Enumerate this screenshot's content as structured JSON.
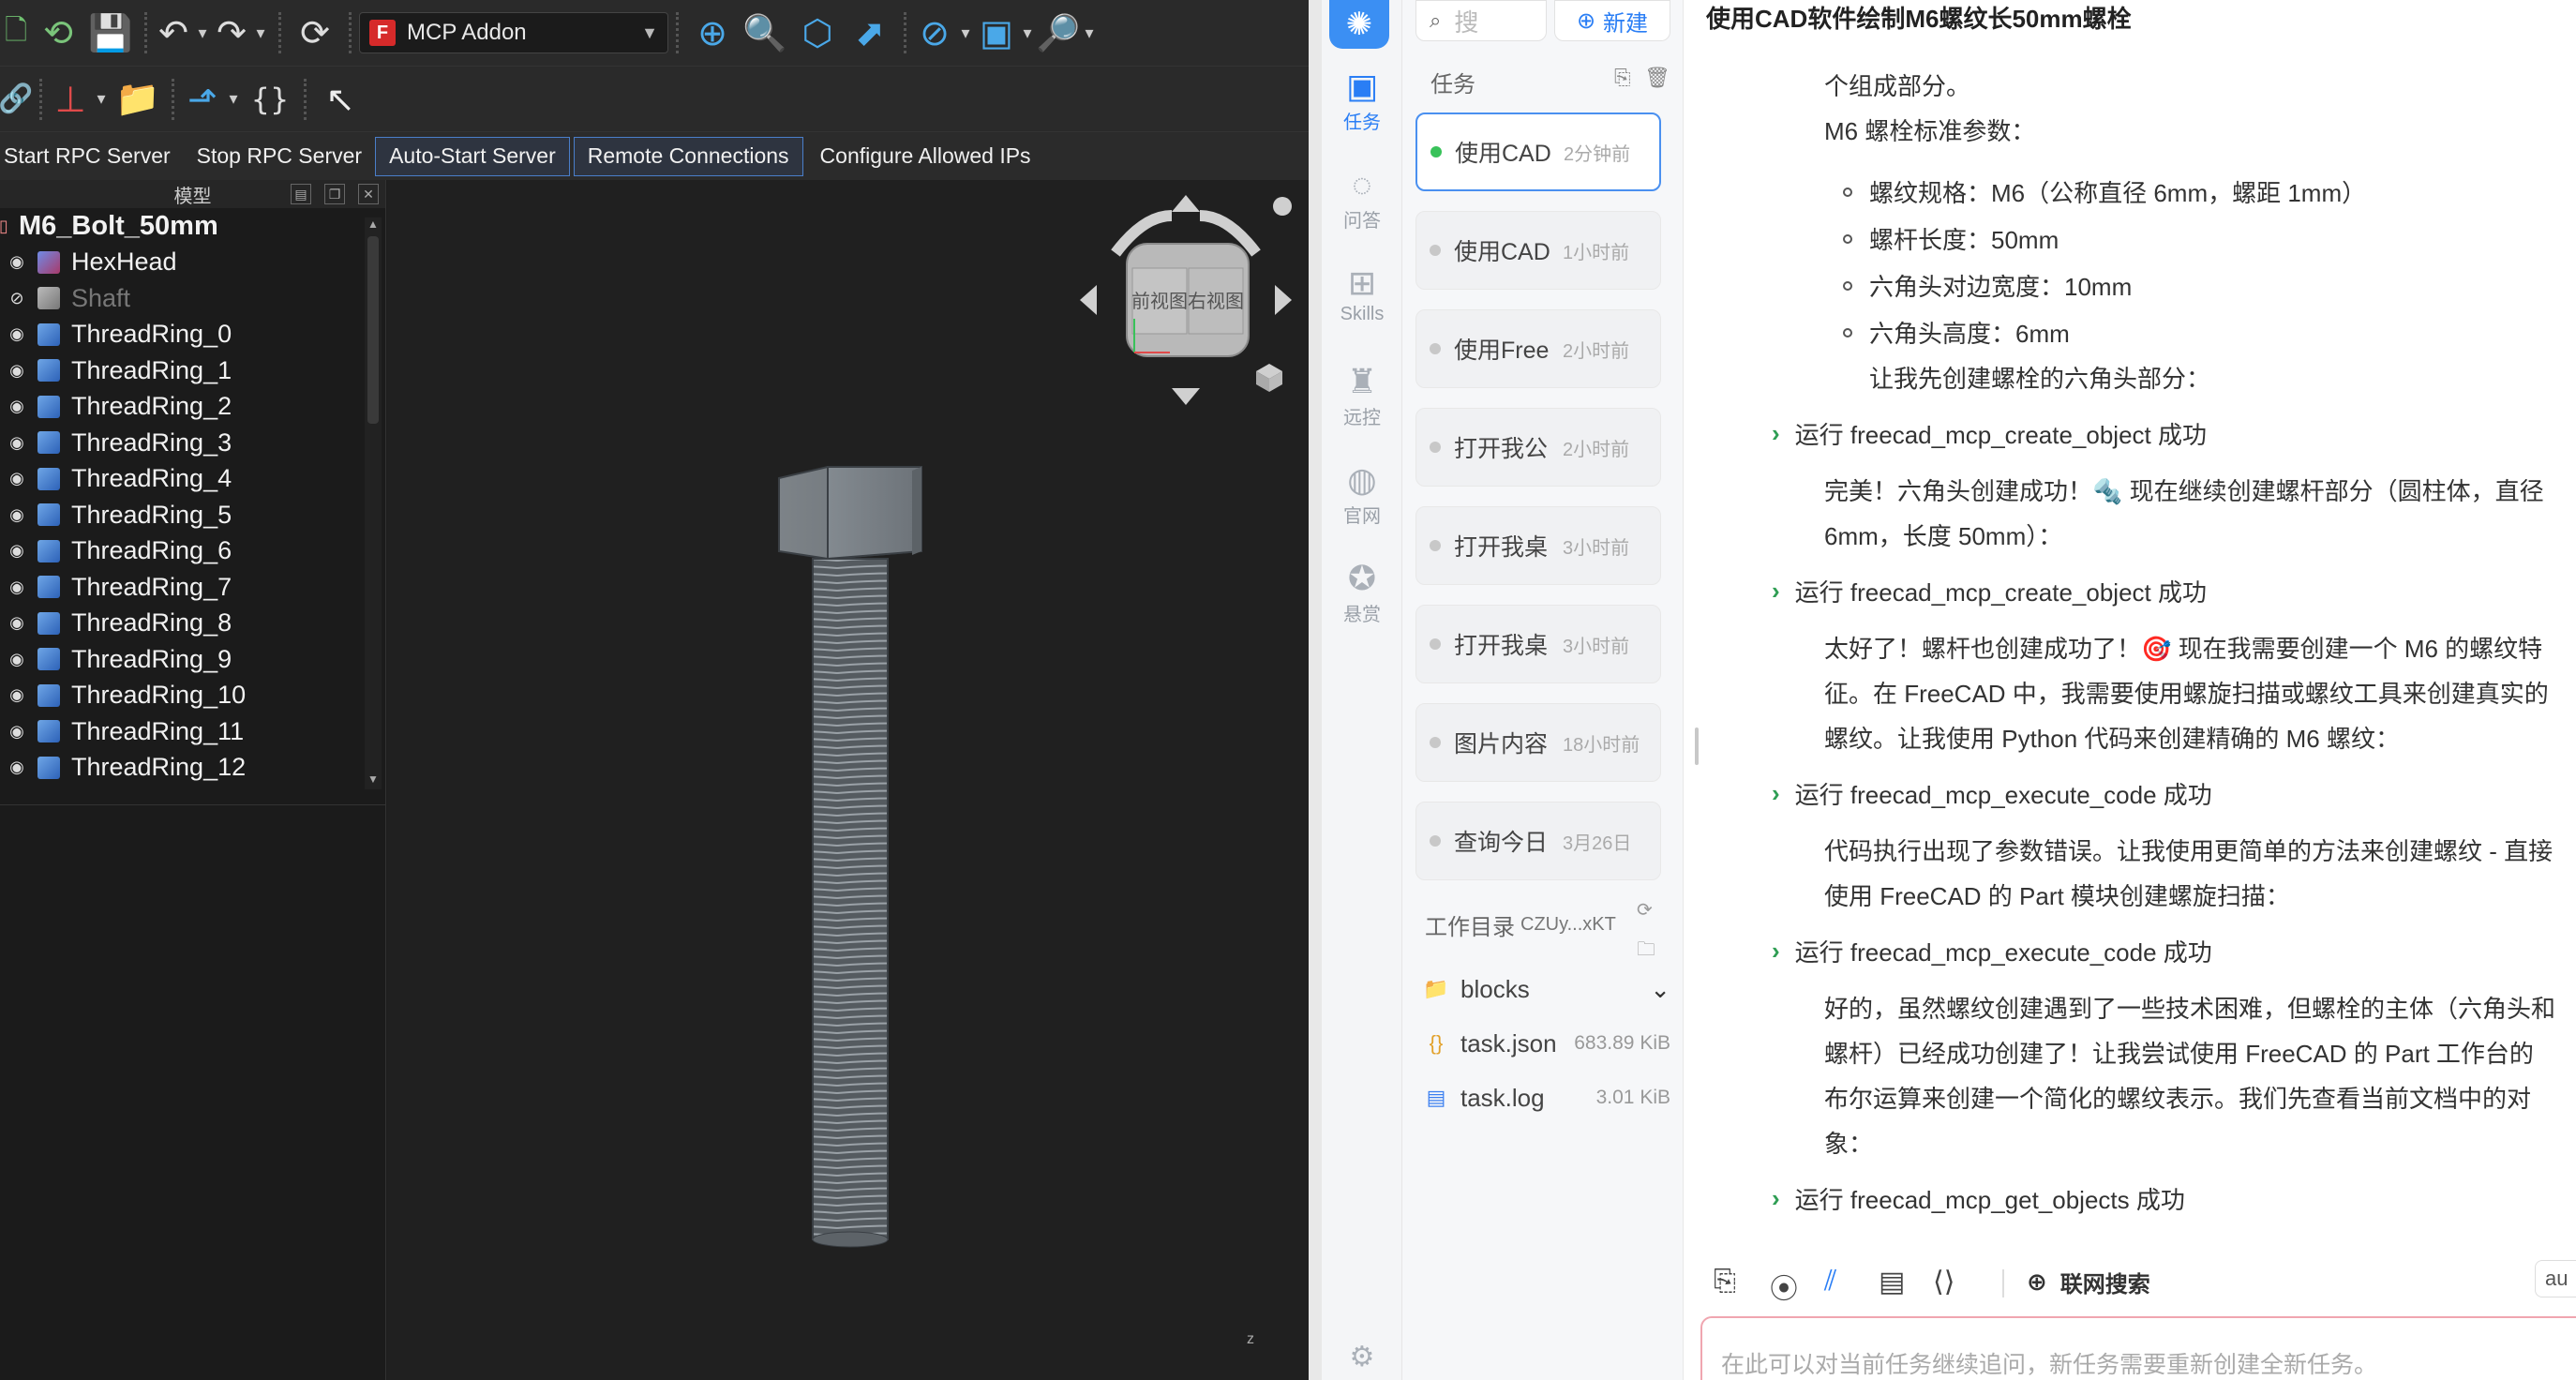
{
  "freecad": {
    "toolbar1": {
      "workbench": "MCP Addon",
      "icons": [
        "new-file-icon",
        "open-file-icon",
        "save-icon",
        "undo-icon",
        "redo-icon",
        "refresh-icon",
        "zoom-fit-icon",
        "zoom-selection-icon",
        "view-cube-icon",
        "measure-icon",
        "draw-style-icon",
        "view-box-icon",
        "zoom-icon"
      ]
    },
    "toolbar2": {
      "braces": "{}",
      "icons": [
        "link-icon",
        "axis-icon",
        "folder-icon",
        "export-icon",
        "pointer-help-icon"
      ]
    },
    "rpc_toolbar": {
      "start": "Start RPC Server",
      "stop": "Stop RPC Server",
      "auto_start": "Auto-Start Server",
      "remote": "Remote Connections",
      "configure": "Configure Allowed IPs"
    },
    "tree": {
      "header": "模型",
      "root": "M6_Bolt_50mm",
      "items": [
        {
          "label": "HexHead",
          "visible": true,
          "kind": "red"
        },
        {
          "label": "Shaft",
          "visible": false,
          "kind": "grey"
        },
        {
          "label": "ThreadRing_0",
          "visible": true,
          "kind": "blue"
        },
        {
          "label": "ThreadRing_1",
          "visible": true,
          "kind": "blue"
        },
        {
          "label": "ThreadRing_2",
          "visible": true,
          "kind": "blue"
        },
        {
          "label": "ThreadRing_3",
          "visible": true,
          "kind": "blue"
        },
        {
          "label": "ThreadRing_4",
          "visible": true,
          "kind": "blue"
        },
        {
          "label": "ThreadRing_5",
          "visible": true,
          "kind": "blue"
        },
        {
          "label": "ThreadRing_6",
          "visible": true,
          "kind": "blue"
        },
        {
          "label": "ThreadRing_7",
          "visible": true,
          "kind": "blue"
        },
        {
          "label": "ThreadRing_8",
          "visible": true,
          "kind": "blue"
        },
        {
          "label": "ThreadRing_9",
          "visible": true,
          "kind": "blue"
        },
        {
          "label": "ThreadRing_10",
          "visible": true,
          "kind": "blue"
        },
        {
          "label": "ThreadRing_11",
          "visible": true,
          "kind": "blue"
        },
        {
          "label": "ThreadRing_12",
          "visible": true,
          "kind": "blue"
        }
      ]
    },
    "navcube": {
      "front": "前视图",
      "right": "右视图"
    },
    "axis_label": "z"
  },
  "app": {
    "rail": [
      {
        "label": "任务",
        "icon": "tasks-icon",
        "active": true
      },
      {
        "label": "问答",
        "icon": "chat-icon",
        "active": false
      },
      {
        "label": "Skills",
        "icon": "skills-icon",
        "active": false
      },
      {
        "label": "远控",
        "icon": "remote-icon",
        "active": false
      },
      {
        "label": "官网",
        "icon": "globe-icon",
        "active": false
      },
      {
        "label": "悬赏",
        "icon": "bounty-icon",
        "active": false
      }
    ],
    "search_placeholder": "搜",
    "new_label": "新建",
    "tasks_label": "任务",
    "tasks": [
      {
        "title": "使用CAD",
        "time": "2分钟前",
        "active": true
      },
      {
        "title": "使用CAD",
        "time": "1小时前",
        "active": false
      },
      {
        "title": "使用Free",
        "time": "2小时前",
        "active": false
      },
      {
        "title": "打开我公",
        "time": "2小时前",
        "active": false
      },
      {
        "title": "打开我桌",
        "time": "3小时前",
        "active": false
      },
      {
        "title": "打开我桌",
        "time": "3小时前",
        "active": false
      },
      {
        "title": "图片内容",
        "time": "18小时前",
        "active": false
      },
      {
        "title": "查询今日",
        "time": "3月26日",
        "active": false
      }
    ],
    "workdir": {
      "label": "工作目录",
      "value": "CZUy...xKT"
    },
    "files": [
      {
        "name": "blocks",
        "size": "",
        "icon": "folder-icon"
      },
      {
        "name": "task.json",
        "size": "683.89 KiB",
        "icon": "json-file-icon"
      },
      {
        "name": "task.log",
        "size": "3.01 KiB",
        "icon": "log-file-icon"
      }
    ],
    "chat": {
      "title": "使用CAD软件绘制M6螺纹长50mm螺栓",
      "intro_partial": "个组成部分。",
      "params_title": "M6 螺栓标准参数：",
      "params": [
        "螺纹规格：M6（公称直径 6mm，螺距 1mm）",
        "螺杆长度：50mm",
        "六角头对边宽度：10mm",
        "六角头高度：6mm"
      ],
      "lead1": "让我先创建螺栓的六角头部分：",
      "tool1": "运行 freecad_mcp_create_object 成功",
      "msg2a": "完美！六角头创建成功！🔩 现在继续创建螺杆部分（圆柱体，直径",
      "msg2b": "6mm，长度 50mm）：",
      "tool2": "运行 freecad_mcp_create_object 成功",
      "msg3a": "太好了！螺杆也创建成功了！🎯 现在我需要创建一个 M6 的螺纹特",
      "msg3b": "征。在 FreeCAD 中，我需要使用螺旋扫描或螺纹工具来创建真实的",
      "msg3c": "螺纹。让我使用 Python 代码来创建精确的 M6 螺纹：",
      "tool3": "运行 freecad_mcp_execute_code 成功",
      "msg4a": "代码执行出现了参数错误。让我使用更简单的方法来创建螺纹 - 直接",
      "msg4b": "使用 FreeCAD 的 Part 模块创建螺旋扫描：",
      "tool4": "运行 freecad_mcp_execute_code 成功",
      "msg5a": "好的，虽然螺纹创建遇到了一些技术困难，但螺栓的主体（六角头和",
      "msg5b": "螺杆）已经成功创建了！让我尝试使用 FreeCAD 的 Part 工作台的",
      "msg5c": "布尔运算来创建一个简化的螺纹表示。我们先查看当前文档中的对",
      "msg5d": "象：",
      "tool5": "运行 freecad_mcp_get_objects 成功",
      "net_search": "联网搜索",
      "model": "au",
      "input_placeholder": "在此可以对当前任务继续追问，新任务需要重新创建全新任务。"
    }
  }
}
